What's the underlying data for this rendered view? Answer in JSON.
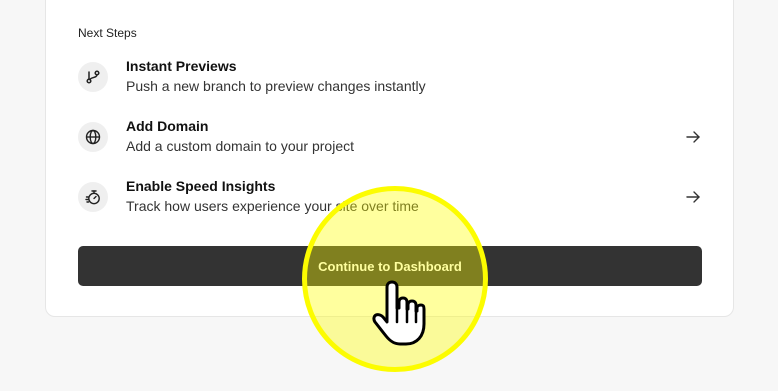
{
  "next_steps": {
    "section_title": "Next Steps",
    "items": [
      {
        "title": "Instant Previews",
        "description": "Push a new branch to preview changes instantly",
        "icon": "git-branch-icon",
        "has_arrow": false
      },
      {
        "title": "Add Domain",
        "description": "Add a custom domain to your project",
        "icon": "globe-icon",
        "has_arrow": true
      },
      {
        "title": "Enable Speed Insights",
        "description": "Track how users experience your site over time",
        "icon": "stopwatch-icon",
        "has_arrow": true
      }
    ]
  },
  "continue_button": {
    "label": "Continue to Dashboard"
  },
  "colors": {
    "button_bg": "#333333",
    "highlight": "#fcfc00"
  }
}
